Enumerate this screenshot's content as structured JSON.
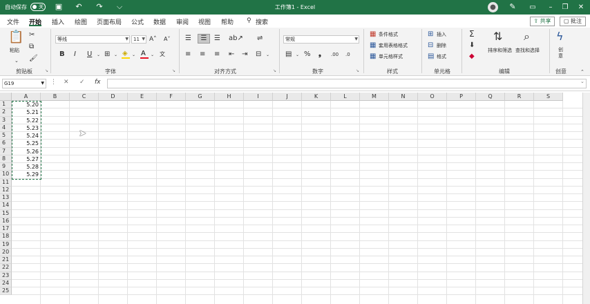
{
  "titlebar": {
    "autosave": "自动保存",
    "autosave_state": "关",
    "title": "工作簿1 - Excel"
  },
  "tabs": [
    "文件",
    "开始",
    "插入",
    "绘图",
    "页面布局",
    "公式",
    "数据",
    "审阅",
    "视图",
    "帮助",
    "搜索"
  ],
  "share": "共享",
  "comment": "批注",
  "ribbon": {
    "clipboard": {
      "label": "剪贴板",
      "paste": "粘贴"
    },
    "font": {
      "label": "字体",
      "name": "等线",
      "size": "11"
    },
    "alignment": {
      "label": "对齐方式"
    },
    "number": {
      "label": "数字",
      "format": "常规"
    },
    "styles": {
      "label": "样式",
      "conditional": "条件格式",
      "table": "套用表格格式",
      "cell": "单元格样式"
    },
    "cells": {
      "label": "单元格",
      "insert": "插入",
      "delete": "删除",
      "format": "格式"
    },
    "editing": {
      "label": "编辑",
      "sort": "排序和筛选",
      "find": "查找和选择"
    },
    "ideas": {
      "label": "创意",
      "button": "创意"
    }
  },
  "namebox": "G19",
  "columns": [
    "A",
    "B",
    "C",
    "D",
    "E",
    "F",
    "G",
    "H",
    "I",
    "J",
    "K",
    "L",
    "M",
    "N",
    "O",
    "P",
    "Q",
    "R",
    "S"
  ],
  "rows": [
    "1",
    "2",
    "3",
    "4",
    "5",
    "6",
    "7",
    "8",
    "9",
    "10",
    "11",
    "12",
    "13",
    "14",
    "15",
    "16",
    "17",
    "18",
    "19",
    "20",
    "21",
    "22",
    "23",
    "24",
    "25"
  ],
  "cells_a": [
    "5.20",
    "5.21",
    "5.22",
    "5.23",
    "5.24",
    "5.25",
    "5.26",
    "5.27",
    "5.28",
    "5.29"
  ]
}
